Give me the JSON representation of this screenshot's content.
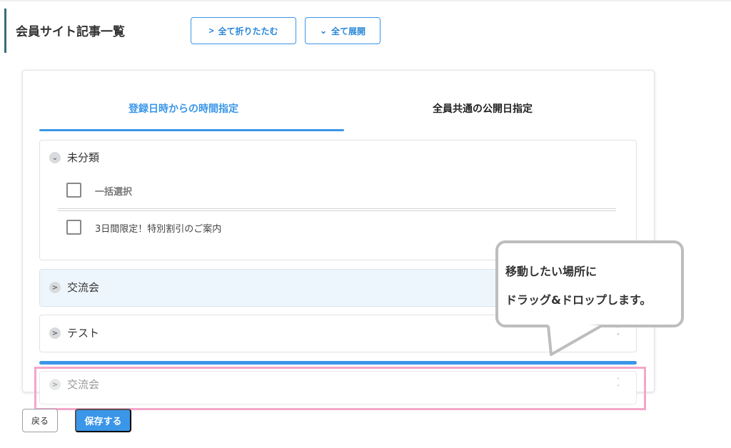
{
  "header": {
    "title": "会員サイト記事一覧",
    "collapse_all_label": "全て折りたたむ",
    "expand_all_label": "全て展開"
  },
  "tabs": [
    {
      "label": "登録日時からの時間指定",
      "active": true
    },
    {
      "label": "全員共通の公開日指定",
      "active": false
    }
  ],
  "categories": {
    "uncategorized": {
      "label": "未分類",
      "expanded": true,
      "select_all_label": "一括選択",
      "items": [
        {
          "label": "3日間限定！特別割引のご案内",
          "checked": false
        }
      ]
    },
    "koryukai": {
      "label": "交流会",
      "expanded": false
    },
    "test": {
      "label": "テスト",
      "expanded": false
    },
    "dragging": {
      "label": "交流会"
    }
  },
  "callout": {
    "line1": "移動したい場所に",
    "line2": "ドラッグ&ドロップします。"
  },
  "footer": {
    "back_label": "戻る",
    "save_label": "保存する"
  },
  "colors": {
    "accent": "#3a96e8",
    "highlight_frame": "#f4a6c8",
    "callout_border": "#bdbdbd"
  },
  "icons": [
    "chevron-right-icon",
    "chevron-down-icon",
    "sort-handle-icon",
    "checkbox-icon"
  ]
}
